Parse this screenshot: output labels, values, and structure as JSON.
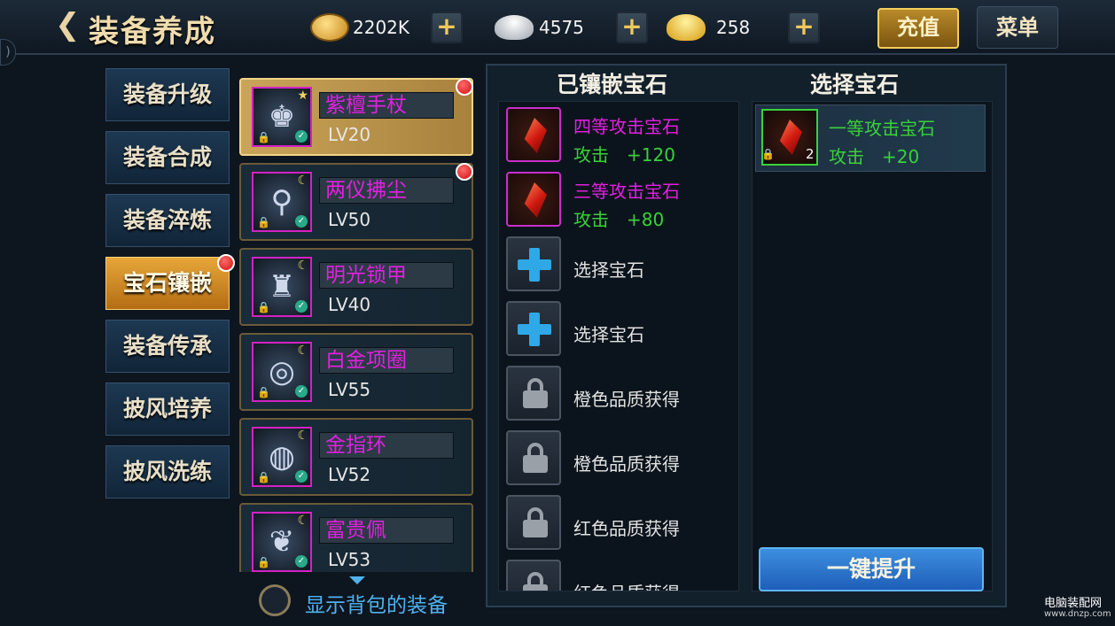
{
  "header": {
    "back_glyph": "❮",
    "title": "装备养成"
  },
  "currency": [
    {
      "name": "coin-icon",
      "value": "2202K",
      "color": "#e8b73a"
    },
    {
      "name": "silver-ingot-icon",
      "value": "4575",
      "color": "#cfd4da"
    },
    {
      "name": "gold-ingot-icon",
      "value": "258",
      "color": "#f2c02a"
    }
  ],
  "plus_label": "+",
  "top_buttons": {
    "recharge": "充值",
    "menu": "菜单"
  },
  "side_tabs": [
    "装备升级",
    "装备合成",
    "装备淬炼",
    "宝石镶嵌",
    "装备传承",
    "披风培养",
    "披风洗练"
  ],
  "active_tab": "宝石镶嵌",
  "equipment": [
    {
      "name": "紫檀手杖",
      "level": "LV20",
      "glyph": "♚",
      "selected": true,
      "red_dot": true
    },
    {
      "name": "两仪拂尘",
      "level": "LV50",
      "glyph": "⚲",
      "selected": false,
      "red_dot": true
    },
    {
      "name": "明光锁甲",
      "level": "LV40",
      "glyph": "♜",
      "selected": false,
      "red_dot": false
    },
    {
      "name": "白金项圈",
      "level": "LV55",
      "glyph": "◎",
      "selected": false,
      "red_dot": false
    },
    {
      "name": "金指环",
      "level": "LV52",
      "glyph": "◍",
      "selected": false,
      "red_dot": false
    },
    {
      "name": "富贵佩",
      "level": "LV53",
      "glyph": "❦",
      "selected": false,
      "red_dot": false
    }
  ],
  "show_bag_label": "显示背包的装备",
  "inlaid_title": "已镶嵌宝石",
  "select_title": "选择宝石",
  "slots": [
    {
      "type": "gem",
      "title": "四等攻击宝石",
      "stat": "攻击　+120"
    },
    {
      "type": "gem",
      "title": "三等攻击宝石",
      "stat": "攻击　+80"
    },
    {
      "type": "add",
      "text": "选择宝石"
    },
    {
      "type": "add",
      "text": "选择宝石"
    },
    {
      "type": "locked",
      "text": "橙色品质获得"
    },
    {
      "type": "locked",
      "text": "橙色品质获得"
    },
    {
      "type": "locked",
      "text": "红色品质获得"
    },
    {
      "type": "locked",
      "text": "红色品质获得"
    }
  ],
  "available_gem": {
    "name": "一等攻击宝石",
    "stat": "攻击　+20",
    "count": "2"
  },
  "upgrade_button": "一键提升",
  "watermark": {
    "line1": "电脑装配网",
    "line2": "www.dnzp.com"
  },
  "colors": {
    "purple_text": "#e220e0",
    "stat_green": "#39d139",
    "accent_gold": "#f0dcae",
    "link_blue": "#4fb2ee"
  }
}
